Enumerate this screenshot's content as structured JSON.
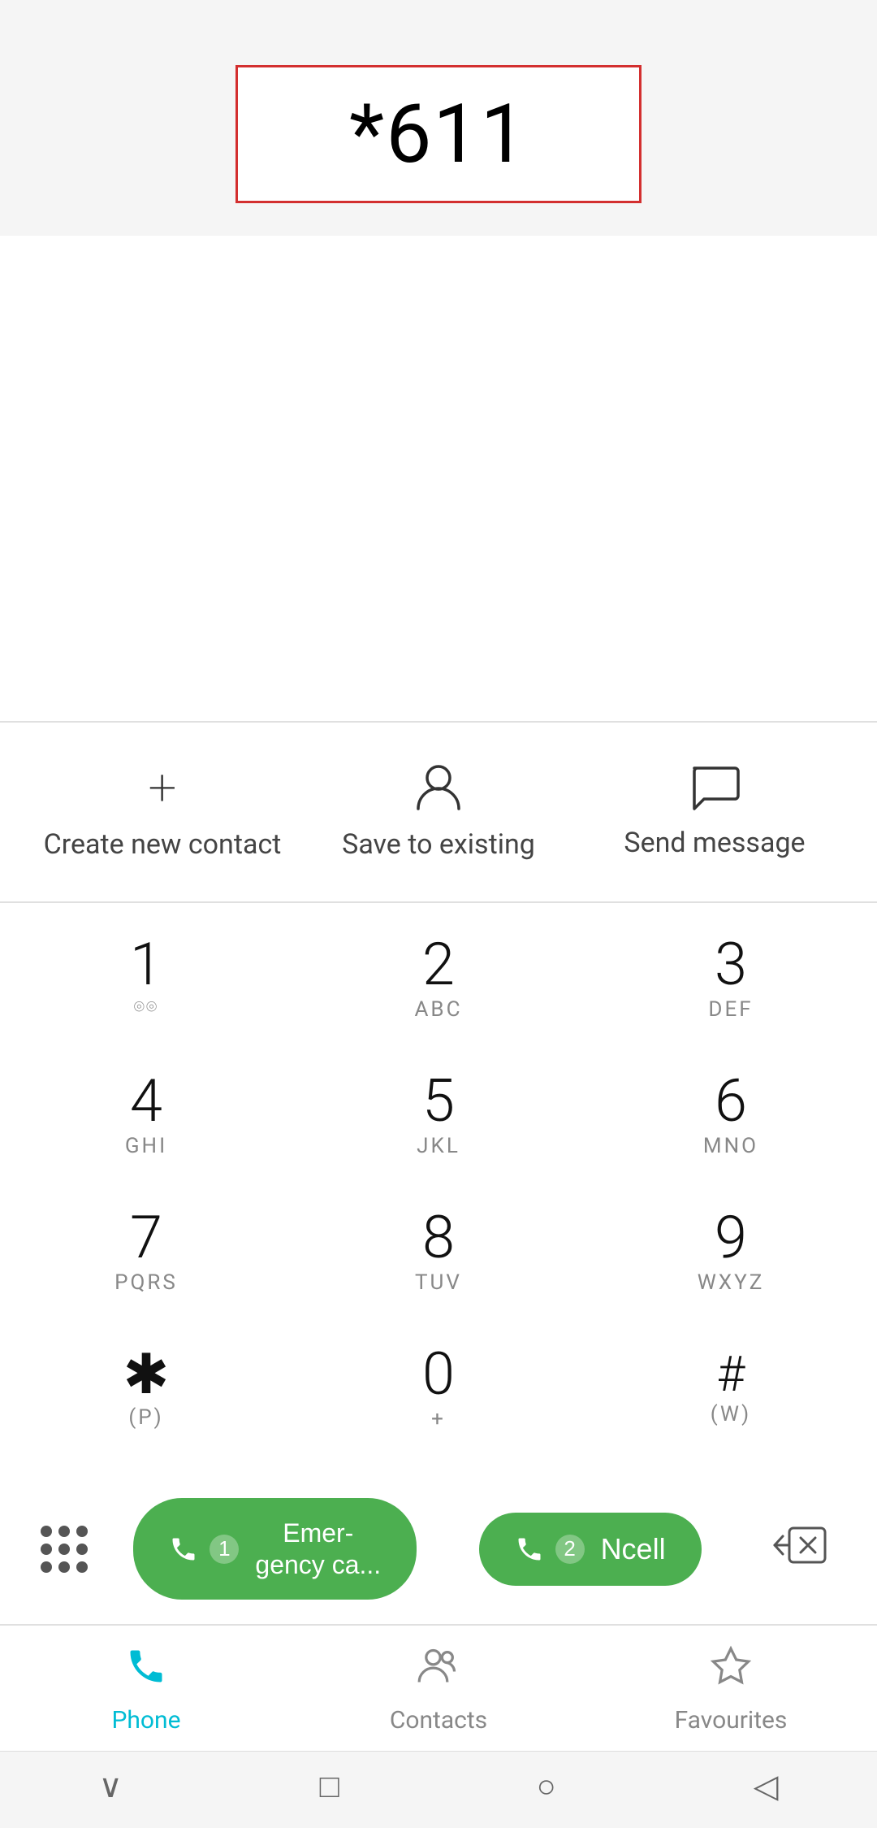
{
  "dialer": {
    "input_value": "*611",
    "input_border_color": "#d32f2f"
  },
  "actions": [
    {
      "id": "create-contact",
      "icon": "+",
      "icon_type": "plus",
      "label": "Create new contact"
    },
    {
      "id": "save-existing",
      "icon": "person",
      "icon_type": "person",
      "label": "Save to existing"
    },
    {
      "id": "send-message",
      "icon": "message",
      "icon_type": "bubble",
      "label": "Send message"
    }
  ],
  "dialpad": {
    "rows": [
      [
        {
          "number": "1",
          "letters": "◌◌"
        },
        {
          "number": "2",
          "letters": "ABC"
        },
        {
          "number": "3",
          "letters": "DEF"
        }
      ],
      [
        {
          "number": "4",
          "letters": "GHI"
        },
        {
          "number": "5",
          "letters": "JKL"
        },
        {
          "number": "6",
          "letters": "MNO"
        }
      ],
      [
        {
          "number": "7",
          "letters": "PQRS"
        },
        {
          "number": "8",
          "letters": "TUV"
        },
        {
          "number": "9",
          "letters": "WXYZ"
        }
      ],
      [
        {
          "number": "*",
          "letters": "(P)"
        },
        {
          "number": "0",
          "letters": "+"
        },
        {
          "number": "#",
          "letters": "(W)"
        }
      ]
    ]
  },
  "call_buttons": [
    {
      "id": "emergency",
      "sim": "1",
      "label": "Emer-\ngency ca..."
    },
    {
      "id": "ncell",
      "sim": "2",
      "label": "Ncell"
    }
  ],
  "bottom_nav": [
    {
      "id": "phone",
      "label": "Phone",
      "active": true
    },
    {
      "id": "contacts",
      "label": "Contacts",
      "active": false
    },
    {
      "id": "favourites",
      "label": "Favourites",
      "active": false
    }
  ],
  "system_nav": {
    "back_label": "◁",
    "home_label": "○",
    "recent_label": "□",
    "down_label": "∨"
  }
}
